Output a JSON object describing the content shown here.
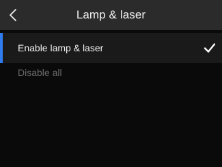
{
  "header": {
    "title": "Lamp & laser",
    "back_icon": "chevron-left-icon"
  },
  "list": {
    "items": [
      {
        "label": "Enable lamp & laser",
        "selected": true,
        "icon": "checkmark-icon"
      },
      {
        "label": "Disable all",
        "selected": false
      }
    ]
  },
  "colors": {
    "header_bg": "#2b2b2b",
    "page_bg": "#0a0a0a",
    "selected_row_bg": "#1a1a1a",
    "accent": "#2f7cf0",
    "text_primary": "#f0f0f0",
    "text_disabled": "#6a6a6a"
  }
}
